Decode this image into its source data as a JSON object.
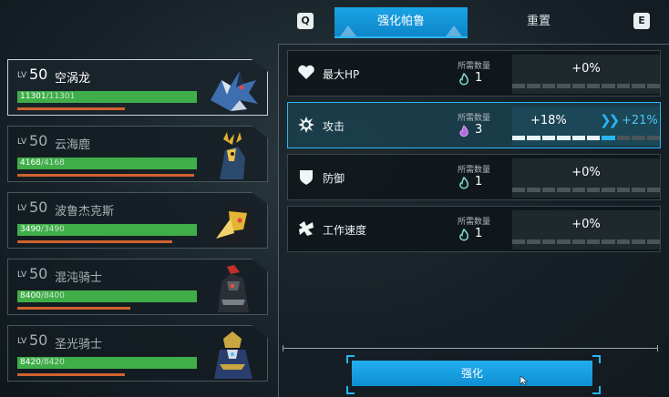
{
  "top_tabs": {
    "left_key": "Q",
    "right_key": "E",
    "tabs": [
      {
        "label": "强化帕鲁",
        "active": true
      },
      {
        "label": "重置",
        "active": false
      }
    ]
  },
  "pal_list": [
    {
      "lv_prefix": "LV",
      "level": "50",
      "name": "空涡龙",
      "hp_current": "11301",
      "hp_max": "/11301",
      "hp_fraction": 1.0,
      "selected": true,
      "portrait": "dragon-portrait-icon"
    },
    {
      "lv_prefix": "LV",
      "level": "50",
      "name": "云海鹿",
      "hp_current": "4168",
      "hp_max": "/4168",
      "hp_fraction": 1.0,
      "selected": false,
      "portrait": "deer-portrait-icon"
    },
    {
      "lv_prefix": "LV",
      "level": "50",
      "name": "波鲁杰克斯",
      "hp_current": "3490",
      "hp_max": "/3490",
      "hp_fraction": 1.0,
      "selected": false,
      "portrait": "knight-portrait-icon"
    },
    {
      "lv_prefix": "LV",
      "level": "50",
      "name": "混沌骑士",
      "hp_current": "8400",
      "hp_max": "/8400",
      "hp_fraction": 1.0,
      "selected": false,
      "portrait": "dark-knight-portrait-icon"
    },
    {
      "lv_prefix": "LV",
      "level": "50",
      "name": "圣光骑士",
      "hp_current": "8420",
      "hp_max": "/8420",
      "hp_fraction": 1.0,
      "selected": false,
      "portrait": "holy-knight-portrait-icon"
    }
  ],
  "stats": [
    {
      "name": "最大HP",
      "icon": "heart-icon",
      "req_label": "所需数量",
      "soul_icon": "soul-small-icon",
      "req_count": "1",
      "current": "+0%",
      "next": "",
      "level": 0,
      "preview_level": 0,
      "segments": 10,
      "highlight": false
    },
    {
      "name": "攻击",
      "icon": "attack-burst-icon",
      "req_label": "所需数量",
      "soul_icon": "soul-large-icon",
      "req_count": "3",
      "current": "+18%",
      "next": "+21%",
      "arrow": "❯❯",
      "level": 6,
      "preview_level": 7,
      "segments": 10,
      "highlight": true
    },
    {
      "name": "防御",
      "icon": "shield-icon",
      "req_label": "所需数量",
      "soul_icon": "soul-small-icon",
      "req_count": "1",
      "current": "+0%",
      "next": "",
      "level": 0,
      "preview_level": 0,
      "segments": 10,
      "highlight": false
    },
    {
      "name": "工作速度",
      "icon": "work-speed-icon",
      "req_label": "所需数量",
      "soul_icon": "soul-small-icon",
      "req_count": "1",
      "current": "+0%",
      "next": "",
      "level": 0,
      "preview_level": 0,
      "segments": 10,
      "highlight": false
    }
  ],
  "enhance_button": {
    "label": "强化"
  },
  "colors": {
    "accent": "#29b6f6",
    "hp": "#3fae49",
    "subbar": "#d1622f",
    "soul_small": "#7fd3c9",
    "soul_large": "#b06ae0"
  }
}
